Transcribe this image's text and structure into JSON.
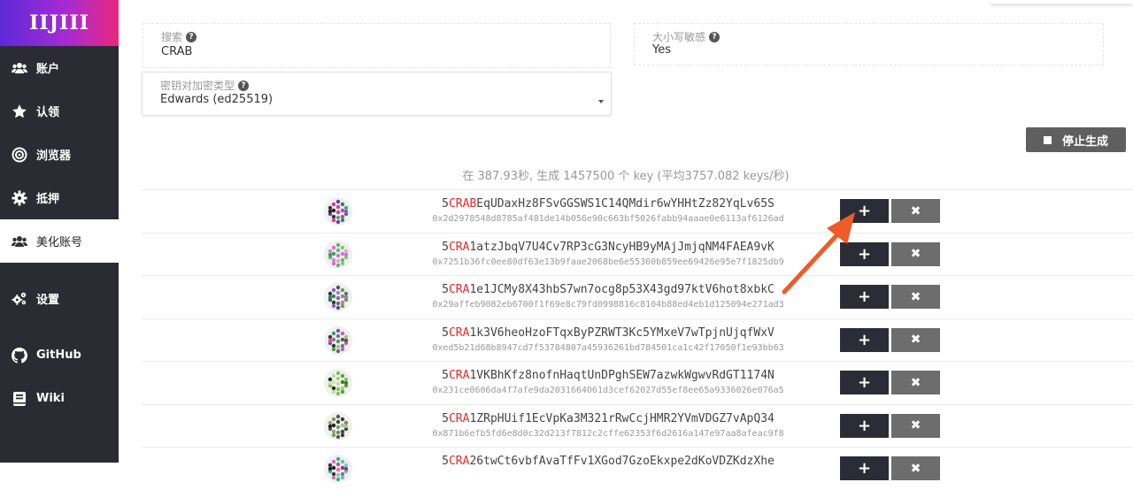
{
  "sidebar": {
    "logo_text": "IIJIII",
    "items": [
      {
        "label": "账户",
        "icon": "users-icon"
      },
      {
        "label": "认领",
        "icon": "star-icon"
      },
      {
        "label": "浏览器",
        "icon": "target-icon"
      },
      {
        "label": "抵押",
        "icon": "gear-icon"
      },
      {
        "label": "美化账号",
        "icon": "users-icon",
        "active": true
      },
      {
        "label": "设置",
        "icon": "cogs-icon"
      },
      {
        "label": "GitHub",
        "icon": "github-icon"
      },
      {
        "label": "Wiki",
        "icon": "book-icon"
      }
    ]
  },
  "form": {
    "search": {
      "label": "搜索",
      "value": "CRAB"
    },
    "case_sensitive": {
      "label": "大小写敏感",
      "value": "Yes"
    },
    "key_type": {
      "label": "密钥对加密类型",
      "value": "Edwards (ed25519)"
    }
  },
  "stop_button": {
    "label": "停止生成"
  },
  "stats_text": "在 387.93秒, 生成 1457500 个 key (平均3757.082 keys/秒)",
  "results": [
    {
      "prefix": "5",
      "match": "CRAB",
      "rest": "EqUDaxHz8FSvGGSWS1C14QMdir6wYHHtZz82YqLv65S",
      "pubkey": "0x2d2978548d8785af481de14b056e90c663bf5026fabb94aaae0e6113af6126ad"
    },
    {
      "prefix": "5",
      "match": "CRA",
      "rest": "1atzJbqV7U4Cv7RP3cG3NcyHB9yMAjJmjqNM4FAEA9vK",
      "pubkey": "0x7251b36fc0ee80df63e13b9faae2068be6e55360b859ee69426e95e7f1825db9"
    },
    {
      "prefix": "5",
      "match": "CRA",
      "rest": "1e1JCMy8X43hbS7wn7ocg8p53X43gd97ktV6hot8xbkC",
      "pubkey": "0x29affeb9082eb6700f1f69e8c79fd0998816c8104b88ed4eb1d125094e271ad3"
    },
    {
      "prefix": "5",
      "match": "CRA",
      "rest": "1k3V6heoHzoFTqxByPZRWT3Kc5YMxeV7wTpjnUjqfWxV",
      "pubkey": "0xed5b21d68b8947cd7f53784807a45936261bd784501ca1c42f17050f1e93bb63"
    },
    {
      "prefix": "5",
      "match": "CRA",
      "rest": "1VKBhKfz8nofnHaqtUnDPghSEW7azwkWgwvRdGT1174N",
      "pubkey": "0x231ce0606da4f7afe9da2031664061d3cef62027d55ef8ee65a9336026e076a5"
    },
    {
      "prefix": "5",
      "match": "CRA",
      "rest": "1ZRpHUif1EcVpKa3M321rRwCcjHMR2YVmVDGZ7vApQ34",
      "pubkey": "0x871b6efb5fd6e8d0c32d213f7812c2cffe62353f6d2616a147e97aa8afeac9f8"
    },
    {
      "prefix": "5",
      "match": "CRA",
      "rest": "26twCt6vbfAvaTfFv1XGod7GzoEkxpe2dKoVDZKdzXhe",
      "pubkey": ""
    }
  ],
  "row_buttons": {
    "add": "+",
    "remove": "✖"
  },
  "colors": {
    "sidebar_bg": "#2b2b33",
    "match_red": "#e02b2b",
    "arrow": "#f05a28"
  }
}
